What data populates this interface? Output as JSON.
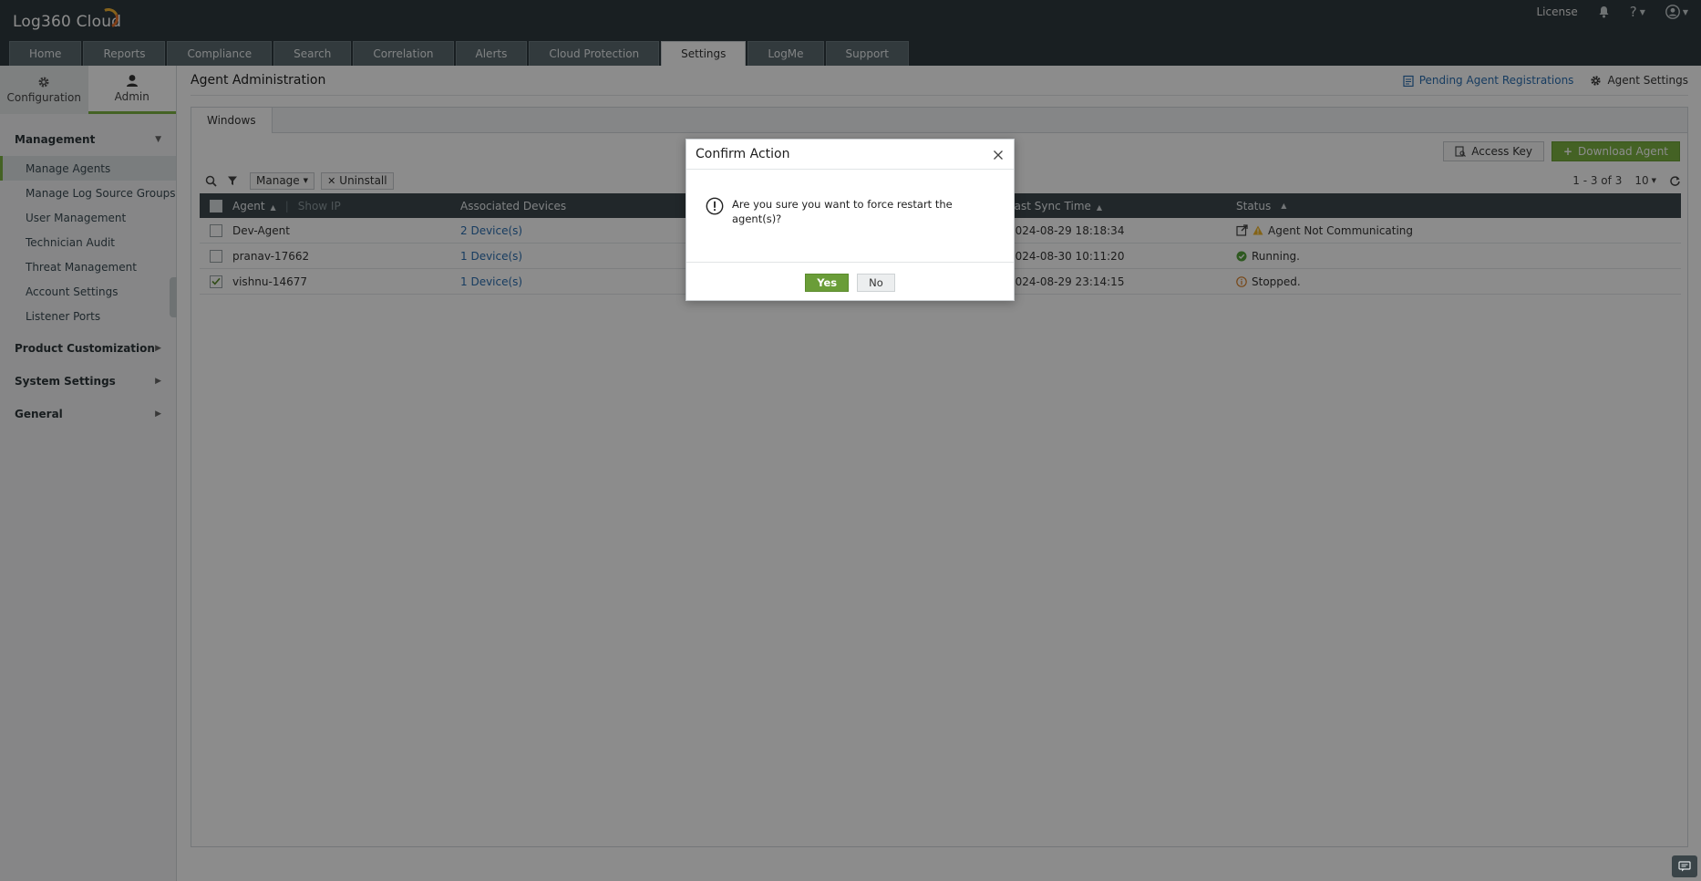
{
  "app": {
    "title": "Log360 Cloud"
  },
  "header": {
    "license_label": "License",
    "help_label": "?",
    "tabs": [
      {
        "label": "Home"
      },
      {
        "label": "Reports"
      },
      {
        "label": "Compliance"
      },
      {
        "label": "Search"
      },
      {
        "label": "Correlation"
      },
      {
        "label": "Alerts"
      },
      {
        "label": "Cloud Protection"
      },
      {
        "label": "Settings",
        "active": true
      },
      {
        "label": "LogMe"
      },
      {
        "label": "Support"
      }
    ]
  },
  "sidebar": {
    "switch": [
      {
        "label": "Configuration",
        "icon": "gear-icon"
      },
      {
        "label": "Admin",
        "icon": "user-icon",
        "active": true
      }
    ],
    "sections": [
      {
        "label": "Management",
        "expanded": true
      },
      {
        "label": "Product Customization"
      },
      {
        "label": "System Settings"
      },
      {
        "label": "General"
      }
    ],
    "items": [
      {
        "label": "Manage Agents",
        "active": true
      },
      {
        "label": "Manage Log Source Groups"
      },
      {
        "label": "User Management"
      },
      {
        "label": "Technician Audit"
      },
      {
        "label": "Threat Management"
      },
      {
        "label": "Account Settings"
      },
      {
        "label": "Listener Ports"
      }
    ]
  },
  "main": {
    "title": "Agent Administration",
    "pending_link": "Pending Agent Registrations",
    "agent_settings": "Agent Settings",
    "subtab": "Windows",
    "access_key": "Access Key",
    "download_agent": "Download Agent",
    "manage_label": "Manage",
    "uninstall_label": "Uninstall",
    "pagination": "1 - 3 of 3",
    "page_size": "10",
    "columns": {
      "agent": "Agent",
      "separator": "|",
      "show_ip": "Show IP",
      "devices": "Associated Devices",
      "sync": "Last Sync Time",
      "status": "Status"
    },
    "rows": [
      {
        "agent": "Dev-Agent",
        "devices": "2 Device(s)",
        "sync": "2024-08-29 18:18:34",
        "status": "Agent Not Communicating",
        "checked": false
      },
      {
        "agent": "pranav-17662",
        "devices": "1 Device(s)",
        "sync": "2024-08-30 10:11:20",
        "status": "Running.",
        "checked": false
      },
      {
        "agent": "vishnu-14677",
        "devices": "1 Device(s)",
        "sync": "2024-08-29 23:14:15",
        "status": "Stopped.",
        "checked": true
      }
    ]
  },
  "modal": {
    "title": "Confirm Action",
    "message": "Are you sure you want to force restart the agent(s)?",
    "yes": "Yes",
    "no": "No"
  },
  "colors": {
    "accent_green": "#7cb342",
    "header_bg": "#2f3a3f",
    "link_blue": "#2a6db0",
    "status_running": "#55a33b",
    "status_warning": "#f0b429",
    "status_stopped": "#d9822b"
  }
}
